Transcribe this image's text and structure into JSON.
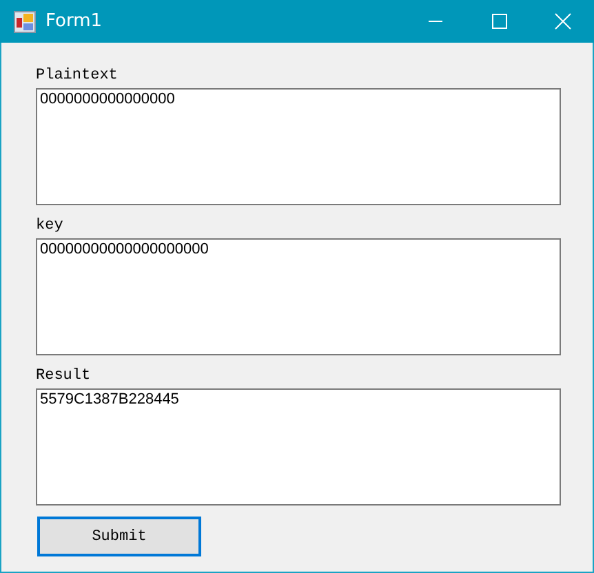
{
  "window": {
    "title": "Form1"
  },
  "fields": [
    {
      "label": "Plaintext",
      "value": "0000000000000000"
    },
    {
      "label": "key",
      "value": "00000000000000000000"
    },
    {
      "label": "Result",
      "value": "5579C1387B228445"
    }
  ],
  "submit_button": {
    "label": "Submit",
    "focused": true
  }
}
